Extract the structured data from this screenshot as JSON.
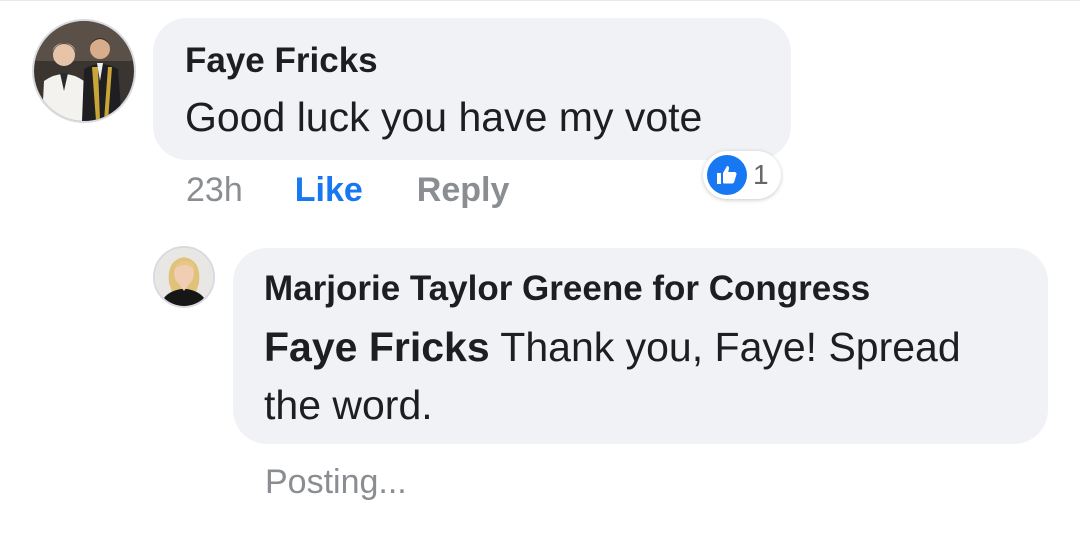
{
  "comments": [
    {
      "author": "Faye Fricks",
      "text": "Good luck you have my vote",
      "timestamp": "23h",
      "like_label": "Like",
      "reply_label": "Reply",
      "reaction_icon": "thumbs-up-icon",
      "reaction_count": "1"
    }
  ],
  "reply": {
    "author": "Marjorie Taylor Greene for Congress",
    "mention": "Faye Fricks",
    "text": " Thank you, Faye! Spread the word.",
    "status": "Posting..."
  },
  "colors": {
    "bubble": "#f0f2f5",
    "accent_blue": "#1877f2",
    "text": "#1c1e21",
    "meta": "#8a8d91"
  }
}
